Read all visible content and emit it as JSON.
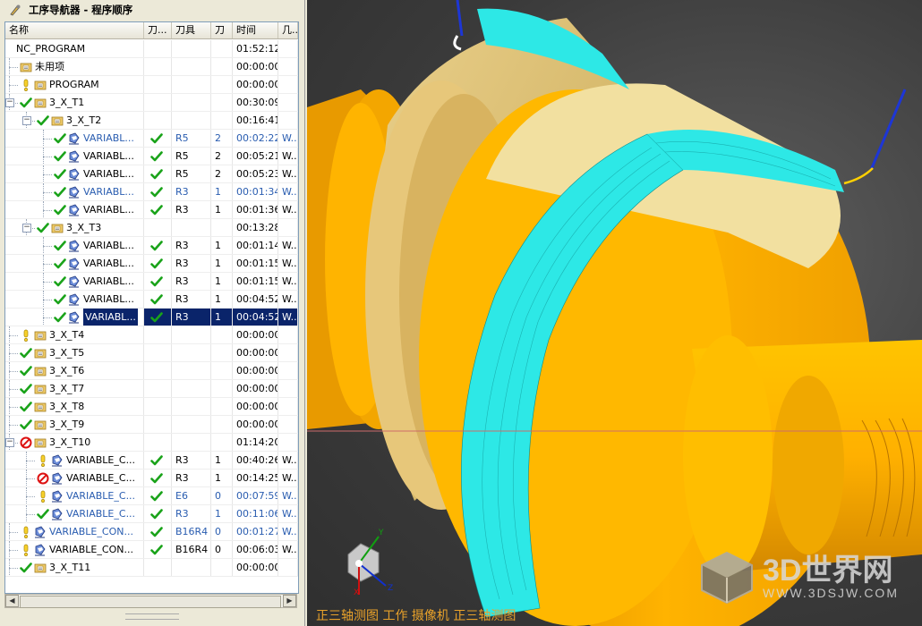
{
  "navigator": {
    "title": "工序导航器 - 程序顺序",
    "columns": [
      "名称",
      "刀...",
      "刀具",
      "刀",
      "时间",
      "几..."
    ],
    "rows": [
      {
        "name": "NC_PROGRAM",
        "level": 0,
        "tree": "",
        "status": "",
        "type": "",
        "tp": "",
        "tool": "",
        "num": "",
        "time": "01:52:12",
        "geom": "",
        "blue": false
      },
      {
        "name": "未用项",
        "level": 1,
        "tree": "",
        "status": "",
        "type": "group",
        "tp": "",
        "tool": "",
        "num": "",
        "time": "00:00:00",
        "geom": "",
        "blue": false
      },
      {
        "name": "PROGRAM",
        "level": 1,
        "tree": "",
        "status": "warn",
        "type": "group",
        "tp": "",
        "tool": "",
        "num": "",
        "time": "00:00:00",
        "geom": "",
        "blue": false
      },
      {
        "name": "3_X_T1",
        "level": 1,
        "tree": "minus",
        "status": "check",
        "type": "group",
        "tp": "",
        "tool": "",
        "num": "",
        "time": "00:30:09",
        "geom": "",
        "blue": false
      },
      {
        "name": "3_X_T2",
        "level": 2,
        "tree": "minus",
        "status": "check",
        "type": "group",
        "tp": "",
        "tool": "",
        "num": "",
        "time": "00:16:41",
        "geom": "",
        "blue": false
      },
      {
        "name": "VARIABL...",
        "level": 3,
        "tree": "",
        "status": "check",
        "type": "op",
        "tp": "check",
        "tool": "R5",
        "num": "2",
        "time": "00:02:22",
        "geom": "W...",
        "blue": true
      },
      {
        "name": "VARIABL...",
        "level": 3,
        "tree": "",
        "status": "check",
        "type": "op",
        "tp": "check",
        "tool": "R5",
        "num": "2",
        "time": "00:05:21",
        "geom": "W...",
        "blue": false
      },
      {
        "name": "VARIABL...",
        "level": 3,
        "tree": "",
        "status": "check",
        "type": "op",
        "tp": "check",
        "tool": "R5",
        "num": "2",
        "time": "00:05:23",
        "geom": "W...",
        "blue": false
      },
      {
        "name": "VARIABL...",
        "level": 3,
        "tree": "",
        "status": "check",
        "type": "op",
        "tp": "check",
        "tool": "R3",
        "num": "1",
        "time": "00:01:34",
        "geom": "W...",
        "blue": true
      },
      {
        "name": "VARIABL...",
        "level": 3,
        "tree": "",
        "status": "check",
        "type": "op",
        "tp": "check",
        "tool": "R3",
        "num": "1",
        "time": "00:01:36",
        "geom": "W...",
        "blue": false
      },
      {
        "name": "3_X_T3",
        "level": 2,
        "tree": "minus",
        "status": "check",
        "type": "group",
        "tp": "",
        "tool": "",
        "num": "",
        "time": "00:13:28",
        "geom": "",
        "blue": false
      },
      {
        "name": "VARIABL...",
        "level": 3,
        "tree": "",
        "status": "check",
        "type": "op",
        "tp": "check",
        "tool": "R3",
        "num": "1",
        "time": "00:01:14",
        "geom": "W...",
        "blue": false
      },
      {
        "name": "VARIABL...",
        "level": 3,
        "tree": "",
        "status": "check",
        "type": "op",
        "tp": "check",
        "tool": "R3",
        "num": "1",
        "time": "00:01:15",
        "geom": "W...",
        "blue": false
      },
      {
        "name": "VARIABL...",
        "level": 3,
        "tree": "",
        "status": "check",
        "type": "op",
        "tp": "check",
        "tool": "R3",
        "num": "1",
        "time": "00:01:15",
        "geom": "W...",
        "blue": false
      },
      {
        "name": "VARIABL...",
        "level": 3,
        "tree": "",
        "status": "check",
        "type": "op",
        "tp": "check",
        "tool": "R3",
        "num": "1",
        "time": "00:04:52",
        "geom": "W...",
        "blue": false
      },
      {
        "name": "VARIABL...",
        "level": 3,
        "tree": "",
        "status": "check",
        "type": "op",
        "tp": "check",
        "tool": "R3",
        "num": "1",
        "time": "00:04:52",
        "geom": "W...",
        "blue": false,
        "selected": true
      },
      {
        "name": "3_X_T4",
        "level": 1,
        "tree": "",
        "status": "warn",
        "type": "group",
        "tp": "",
        "tool": "",
        "num": "",
        "time": "00:00:00",
        "geom": "",
        "blue": false
      },
      {
        "name": "3_X_T5",
        "level": 1,
        "tree": "",
        "status": "check",
        "type": "group",
        "tp": "",
        "tool": "",
        "num": "",
        "time": "00:00:00",
        "geom": "",
        "blue": false
      },
      {
        "name": "3_X_T6",
        "level": 1,
        "tree": "",
        "status": "check",
        "type": "group",
        "tp": "",
        "tool": "",
        "num": "",
        "time": "00:00:00",
        "geom": "",
        "blue": false
      },
      {
        "name": "3_X_T7",
        "level": 1,
        "tree": "",
        "status": "check",
        "type": "group",
        "tp": "",
        "tool": "",
        "num": "",
        "time": "00:00:00",
        "geom": "",
        "blue": false
      },
      {
        "name": "3_X_T8",
        "level": 1,
        "tree": "",
        "status": "check",
        "type": "group",
        "tp": "",
        "tool": "",
        "num": "",
        "time": "00:00:00",
        "geom": "",
        "blue": false
      },
      {
        "name": "3_X_T9",
        "level": 1,
        "tree": "",
        "status": "check",
        "type": "group",
        "tp": "",
        "tool": "",
        "num": "",
        "time": "00:00:00",
        "geom": "",
        "blue": false
      },
      {
        "name": "3_X_T10",
        "level": 1,
        "tree": "minus",
        "status": "no",
        "type": "group",
        "tp": "",
        "tool": "",
        "num": "",
        "time": "01:14:20",
        "geom": "",
        "blue": false
      },
      {
        "name": "VARIABLE_C...",
        "level": 2,
        "tree": "",
        "status": "warn",
        "type": "op",
        "tp": "check",
        "tool": "R3",
        "num": "1",
        "time": "00:40:26",
        "geom": "W...",
        "blue": false
      },
      {
        "name": "VARIABLE_C...",
        "level": 2,
        "tree": "",
        "status": "no",
        "type": "op",
        "tp": "check",
        "tool": "R3",
        "num": "1",
        "time": "00:14:25",
        "geom": "W...",
        "blue": false
      },
      {
        "name": "VARIABLE_C...",
        "level": 2,
        "tree": "",
        "status": "warn",
        "type": "op",
        "tp": "check",
        "tool": "E6",
        "num": "0",
        "time": "00:07:59",
        "geom": "W...",
        "blue": true
      },
      {
        "name": "VARIABLE_C...",
        "level": 2,
        "tree": "",
        "status": "check",
        "type": "op",
        "tp": "check",
        "tool": "R3",
        "num": "1",
        "time": "00:11:06",
        "geom": "W...",
        "blue": true
      },
      {
        "name": "VARIABLE_CON...",
        "level": 1,
        "tree": "",
        "status": "warn",
        "type": "op",
        "tp": "check",
        "tool": "B16R4",
        "num": "0",
        "time": "00:01:27",
        "geom": "W...",
        "blue": true
      },
      {
        "name": "VARIABLE_CON...",
        "level": 1,
        "tree": "",
        "status": "warn",
        "type": "op",
        "tp": "check",
        "tool": "B16R4",
        "num": "0",
        "time": "00:06:03",
        "geom": "W...",
        "blue": false
      },
      {
        "name": "3_X_T11",
        "level": 1,
        "tree": "",
        "status": "check",
        "type": "group",
        "tp": "",
        "tool": "",
        "num": "",
        "time": "00:00:00",
        "geom": "",
        "blue": false
      }
    ]
  },
  "viewport": {
    "label": "正三轴测图 工作 摄像机 正三轴测图",
    "axes": [
      "X",
      "Y",
      "Z"
    ],
    "watermark": {
      "logo_text": "3D世界网",
      "url": "WWW.3DSJW.COM"
    },
    "colors": {
      "part": "#f5a800",
      "toolpath": "#2de8e6",
      "background": "#3c3c3c"
    }
  }
}
